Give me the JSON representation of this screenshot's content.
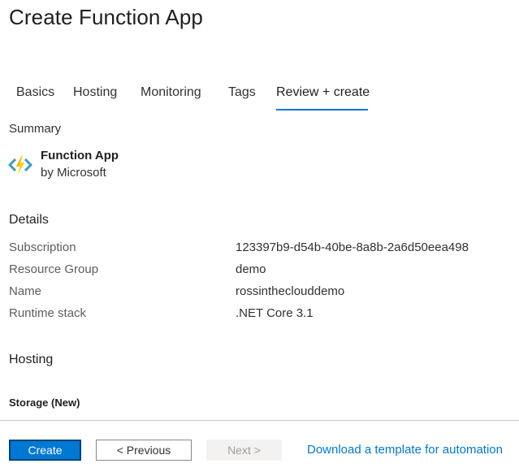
{
  "page": {
    "title": "Create Function App"
  },
  "tabs": [
    {
      "label": "Basics",
      "active": false
    },
    {
      "label": "Hosting",
      "active": false
    },
    {
      "label": "Monitoring",
      "active": false
    },
    {
      "label": "Tags",
      "active": false
    },
    {
      "label": "Review + create",
      "active": true
    }
  ],
  "summary": {
    "label": "Summary",
    "product_name": "Function App",
    "product_vendor": "by Microsoft",
    "icon": "function-app-icon"
  },
  "details": {
    "heading": "Details",
    "rows": [
      {
        "key": "Subscription",
        "value": "123397b9-d54b-40be-8a8b-2a6d50eea498"
      },
      {
        "key": "Resource Group",
        "value": "demo"
      },
      {
        "key": "Name",
        "value": "rossintheclouddemo"
      },
      {
        "key": "Runtime stack",
        "value": ".NET Core 3.1"
      }
    ]
  },
  "hosting": {
    "heading": "Hosting",
    "storage_heading": "Storage (New)"
  },
  "footer": {
    "create_label": "Create",
    "previous_label": "< Previous",
    "next_label": "Next >",
    "automation_link": "Download a template for automation"
  },
  "colors": {
    "accent": "#0078d4",
    "icon_bolt": "#fcd116",
    "icon_bracket": "#3999c6"
  }
}
